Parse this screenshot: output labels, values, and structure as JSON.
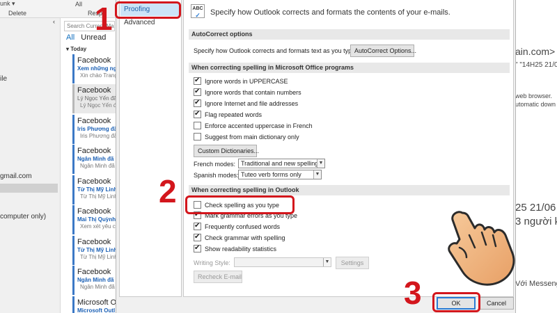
{
  "background": {
    "ribbon": {
      "delete_label": "Delete",
      "respond_label": "Respo",
      "all_label": "All",
      "junk_label": "unk ▾"
    },
    "folders": {
      "account": "gmail.com",
      "other": "computer only)",
      "item_file": "ile"
    },
    "search_placeholder": "Search Current Mailb",
    "filter_all": "All",
    "filter_unread": "Unread",
    "group_today": "Today",
    "emails": [
      {
        "from": "Facebook",
        "subject": "Xem những ngư",
        "preview": "Xin chào Trang"
      },
      {
        "from": "Facebook",
        "subject": "Lý Ngọc Yến đã g",
        "preview": "Lý Ngọc Yến đ"
      },
      {
        "from": "Facebook",
        "subject": "Iris Phương đã g",
        "preview": "Iris Phương đã"
      },
      {
        "from": "Facebook",
        "subject": "Ngân Minh đã g",
        "preview": "Ngân Minh đã"
      },
      {
        "from": "Facebook",
        "subject": "Từ Thị Mỹ Linh",
        "preview": "Từ Thị Mỹ Linh"
      },
      {
        "from": "Facebook",
        "subject": "Mai Thị Quỳnh đ",
        "preview": "Xem xét yêu cầ"
      },
      {
        "from": "Facebook",
        "subject": "Từ Thị Mỹ Linh",
        "preview": "Từ Thị Mỹ Linh"
      },
      {
        "from": "Facebook",
        "subject": "Ngân Minh đã g",
        "preview": "Ngân Minh đã g"
      },
      {
        "from": "Microsoft Out",
        "subject": "Microsoft Outl",
        "preview": ""
      }
    ],
    "reading": {
      "line1": "ain.com>",
      "line2": "\" \"14H25 21/0",
      "line3": "web browser.",
      "line4": "utomatic down",
      "line5": "25 21/06",
      "line6": "3 người k",
      "line7": "Với Messeng"
    }
  },
  "dialog": {
    "nav": [
      {
        "label": "Proofing",
        "active": true
      },
      {
        "label": "Advanced",
        "active": false
      }
    ],
    "intro_icon": "ABC",
    "intro_text": "Specify how Outlook corrects and formats the contents of your e-mails.",
    "autocorrect_section": "AutoCorrect options",
    "autocorrect_desc": "Specify how Outlook corrects and formats text as you type.",
    "autocorrect_button": "AutoCorrect Options...",
    "office_section": "When correcting spelling in Microsoft Office programs",
    "office_options": [
      {
        "label": "Ignore words in UPPERCASE",
        "checked": true
      },
      {
        "label": "Ignore words that contain numbers",
        "checked": true
      },
      {
        "label": "Ignore Internet and file addresses",
        "checked": true
      },
      {
        "label": "Flag repeated words",
        "checked": true
      },
      {
        "label": "Enforce accented uppercase in French",
        "checked": false
      },
      {
        "label": "Suggest from main dictionary only",
        "checked": false
      }
    ],
    "custom_dict_button": "Custom Dictionaries...",
    "french_modes_label": "French modes:",
    "french_modes_value": "Traditional and new spellings",
    "spanish_modes_label": "Spanish modes:",
    "spanish_modes_value": "Tuteo verb forms only",
    "outlook_section": "When correcting spelling in Outlook",
    "outlook_options": [
      {
        "label": "Check spelling as you type",
        "checked": false
      },
      {
        "label": "Mark grammar errors as you type",
        "checked": true
      },
      {
        "label": "Frequently confused words",
        "checked": true
      },
      {
        "label": "Check grammar with spelling",
        "checked": true
      },
      {
        "label": "Show readability statistics",
        "checked": true
      }
    ],
    "writing_style_label": "Writing Style:",
    "settings_button": "Settings",
    "recheck_button": "Recheck E-mail",
    "ok_button": "OK",
    "cancel_button": "Cancel"
  },
  "annotations": {
    "step1": "1",
    "step2": "2",
    "step3": "3",
    "highlight_color": "#d3161c"
  }
}
